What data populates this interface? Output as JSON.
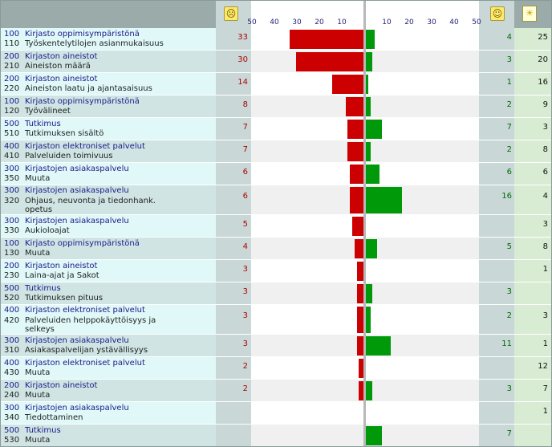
{
  "chart_data": {
    "type": "bar",
    "orientation": "horizontal-diverging",
    "x_ticks_negative": [
      "50",
      "40",
      "30",
      "20",
      "10"
    ],
    "x_ticks_positive": [
      "10",
      "20",
      "30",
      "40",
      "50"
    ],
    "xlim": [
      0,
      50
    ],
    "header_icons": {
      "negative": "sad-smiley-icon",
      "positive": "happy-smiley-icon",
      "ideas": "lightbulb-icon"
    },
    "colors": {
      "negative": "#cc0000",
      "positive": "#00990a",
      "label_panel": "#e0f8f8",
      "alt_row": "#f0f0f0"
    },
    "rows": [
      {
        "code1": "100",
        "cat": "Kirjasto oppimisympäristönä",
        "code2": "110",
        "sub": [
          "Työskentelytilojen asianmukaisuus"
        ],
        "neg": 33,
        "pos": 4,
        "ideas": 25
      },
      {
        "code1": "200",
        "cat": "Kirjaston aineistot",
        "code2": "210",
        "sub": [
          "Aineiston määrä"
        ],
        "neg": 30,
        "pos": 3,
        "ideas": 20
      },
      {
        "code1": "200",
        "cat": "Kirjaston aineistot",
        "code2": "220",
        "sub": [
          "Aineiston laatu ja ajantasaisuus"
        ],
        "neg": 14,
        "pos": 1,
        "ideas": 16
      },
      {
        "code1": "100",
        "cat": "Kirjasto oppimisympäristönä",
        "code2": "120",
        "sub": [
          "Työvälineet"
        ],
        "neg": 8,
        "pos": 2,
        "ideas": 9
      },
      {
        "code1": "500",
        "cat": "Tutkimus",
        "code2": "510",
        "sub": [
          "Tutkimuksen sisältö"
        ],
        "neg": 7,
        "pos": 7,
        "ideas": 3
      },
      {
        "code1": "400",
        "cat": "Kirjaston elektroniset palvelut",
        "code2": "410",
        "sub": [
          "Palveluiden toimivuus"
        ],
        "neg": 7,
        "pos": 2,
        "ideas": 8
      },
      {
        "code1": "300",
        "cat": "Kirjastojen asiakaspalvelu",
        "code2": "350",
        "sub": [
          "Muuta"
        ],
        "neg": 6,
        "pos": 6,
        "ideas": 6
      },
      {
        "code1": "300",
        "cat": "Kirjastojen asiakaspalvelu",
        "code2": "320",
        "sub": [
          "Ohjaus, neuvonta ja tiedonhank.",
          "opetus"
        ],
        "neg": 6,
        "pos": 16,
        "ideas": 4
      },
      {
        "code1": "300",
        "cat": "Kirjastojen asiakaspalvelu",
        "code2": "330",
        "sub": [
          "Aukioloajat"
        ],
        "neg": 5,
        "pos": null,
        "ideas": 3
      },
      {
        "code1": "100",
        "cat": "Kirjasto oppimisympäristönä",
        "code2": "130",
        "sub": [
          "Muuta"
        ],
        "neg": 4,
        "pos": 5,
        "ideas": 8
      },
      {
        "code1": "200",
        "cat": "Kirjaston aineistot",
        "code2": "230",
        "sub": [
          "Laina-ajat ja Sakot"
        ],
        "neg": 3,
        "pos": null,
        "ideas": 1
      },
      {
        "code1": "500",
        "cat": "Tutkimus",
        "code2": "520",
        "sub": [
          "Tutkimuksen pituus"
        ],
        "neg": 3,
        "pos": 3,
        "ideas": null
      },
      {
        "code1": "400",
        "cat": "Kirjaston elektroniset palvelut",
        "code2": "420",
        "sub": [
          "Palveluiden helppokäyttöisyys ja",
          "selkeys"
        ],
        "neg": 3,
        "pos": 2,
        "ideas": 3
      },
      {
        "code1": "300",
        "cat": "Kirjastojen asiakaspalvelu",
        "code2": "310",
        "sub": [
          "Asiakaspalvelijan ystävällisyys"
        ],
        "neg": 3,
        "pos": 11,
        "ideas": 1
      },
      {
        "code1": "400",
        "cat": "Kirjaston elektroniset palvelut",
        "code2": "430",
        "sub": [
          "Muuta"
        ],
        "neg": 2,
        "pos": null,
        "ideas": 12
      },
      {
        "code1": "200",
        "cat": "Kirjaston aineistot",
        "code2": "240",
        "sub": [
          "Muuta"
        ],
        "neg": 2,
        "pos": 3,
        "ideas": 7
      },
      {
        "code1": "300",
        "cat": "Kirjastojen asiakaspalvelu",
        "code2": "340",
        "sub": [
          "Tiedottaminen"
        ],
        "neg": null,
        "pos": null,
        "ideas": 1
      },
      {
        "code1": "500",
        "cat": "Tutkimus",
        "code2": "530",
        "sub": [
          "Muuta"
        ],
        "neg": null,
        "pos": 7,
        "ideas": null
      }
    ]
  }
}
